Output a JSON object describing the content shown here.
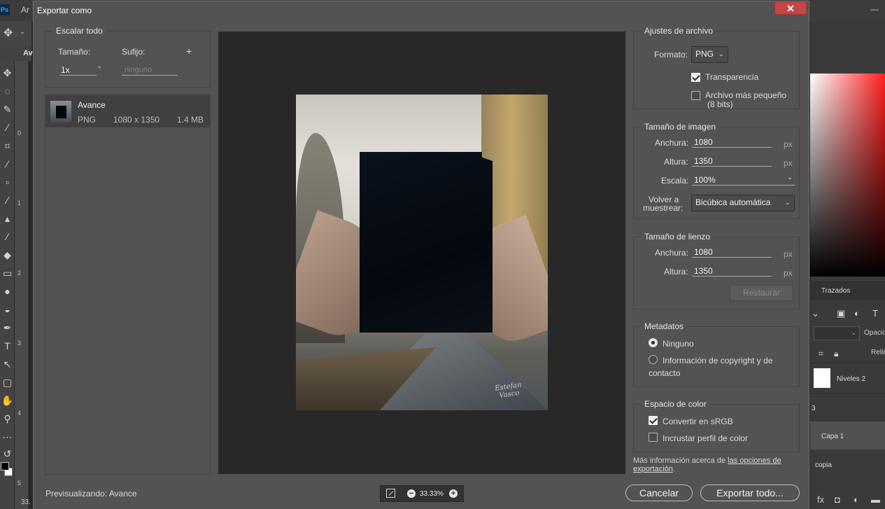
{
  "app": {
    "logo": "Ps",
    "menubar_text": "Ar",
    "minimize_icon": "—",
    "tab_label": "Av",
    "zoom_readout": "33.",
    "ruler_numbers": [
      "0",
      "1",
      "2",
      "3",
      "4",
      "5"
    ]
  },
  "right_panel": {
    "tab": "Trazados",
    "opacity_label": "Opacio",
    "fill_label": "Relle",
    "layers": [
      {
        "name": "Niveles 2"
      },
      {
        "name": "3"
      },
      {
        "name": "Capa 1"
      },
      {
        "name": "copia"
      }
    ]
  },
  "dialog": {
    "title": "Exportar como",
    "close_icon": "✕",
    "scale_all": {
      "title": "Escalar todo",
      "size_label": "Tamaño:",
      "suffix_label": "Sufijo:",
      "add_icon": "+",
      "size_value": "1x",
      "suffix_placeholder": "ninguno"
    },
    "asset": {
      "name": "Avance",
      "format": "PNG",
      "dimensions": "1080 x 1350",
      "file_size": "1.4 MB"
    },
    "preview": {
      "signature": "Estefan\nVasco",
      "zoom": "33.33%"
    },
    "file_settings": {
      "title": "Ajustes de archivo",
      "format_label": "Formato:",
      "format_value": "PNG",
      "transparency_label": "Transparencia",
      "transparency_checked": true,
      "smaller_file_label": "Archivo más pequeño",
      "smaller_file_sub": "(8 bits)",
      "smaller_file_checked": false
    },
    "image_size": {
      "title": "Tamaño de imagen",
      "width_label": "Anchura:",
      "width_value": "1080",
      "height_label": "Altura:",
      "height_value": "1350",
      "scale_label": "Escala:",
      "scale_value": "100%",
      "resample_label_1": "Volver a",
      "resample_label_2": "muestrear:",
      "resample_value": "Bicúbica automática",
      "unit": "px"
    },
    "canvas_size": {
      "title": "Tamaño de lienzo",
      "width_label": "Anchura:",
      "width_value": "1080",
      "height_label": "Altura:",
      "height_value": "1350",
      "unit": "px",
      "restore_label": "Restaurar"
    },
    "metadata": {
      "title": "Metadatos",
      "option_none": "Ninguno",
      "option_copyright_1": "Información de copyright y de",
      "option_copyright_2": "contacto",
      "selected": "Ninguno"
    },
    "color_space": {
      "title": "Espacio de color",
      "srgb_label": "Convertir en sRGB",
      "srgb_checked": true,
      "embed_label": "Incrustar perfil de color",
      "embed_checked": false
    },
    "more_info": {
      "text": "Más información acerca de ",
      "link_1": "las opciones de",
      "link_2": "exportación",
      "end": "."
    },
    "footer": {
      "previewing_label": "Previsualizando:",
      "previewing_name": "Avance",
      "cancel_label": "Cancelar",
      "export_label": "Exportar todo..."
    }
  }
}
